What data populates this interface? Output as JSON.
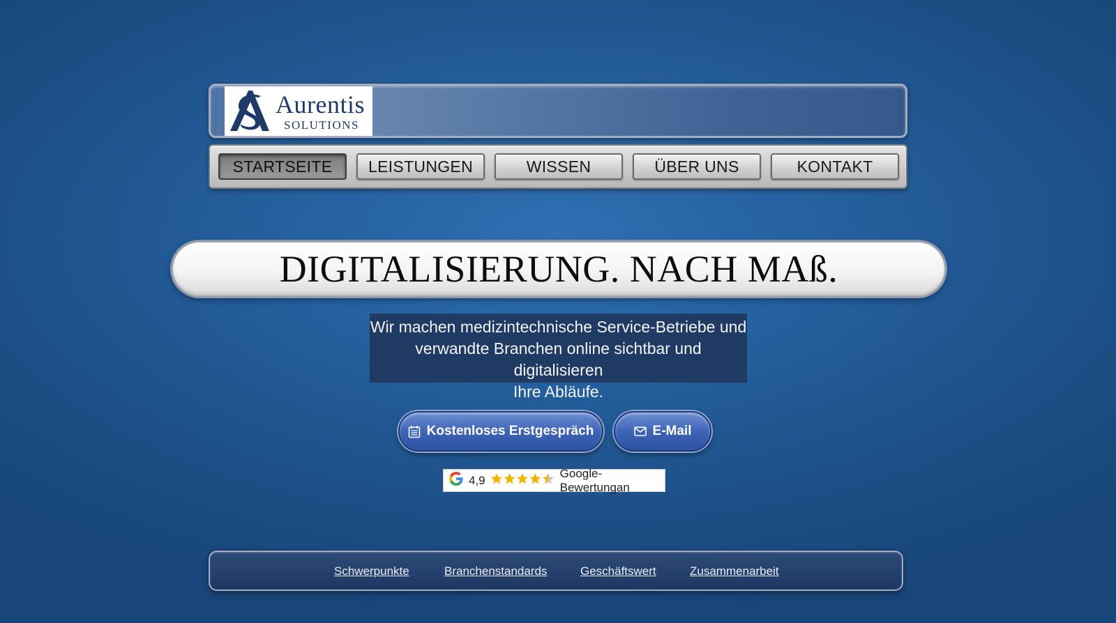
{
  "brand": {
    "name": "Aurentis",
    "tagline": "SOLUTIONS",
    "monogram": "AS",
    "color": "#1e3a6b"
  },
  "nav": {
    "items": [
      {
        "label": "STARTSEITE",
        "active": true
      },
      {
        "label": "LEISTUNGEN",
        "active": false
      },
      {
        "label": "WISSEN",
        "active": false
      },
      {
        "label": "ÜBER UNS",
        "active": false
      },
      {
        "label": "KONTAKT",
        "active": false
      }
    ]
  },
  "hero": {
    "title": "DIGITALISIERUNG. NACH MAß.",
    "subtitle_lines": [
      "Wir machen medizintechnische Service-Betriebe und",
      "verwandte Branchen online sichtbar und digitalisieren",
      "Ihre Abläufe."
    ]
  },
  "cta": {
    "primary": {
      "label": "Kostenloses Erstgespräch",
      "icon": "calendar-icon"
    },
    "secondary": {
      "label": "E-Mail",
      "icon": "mail-icon"
    }
  },
  "rating": {
    "score": "4,9",
    "stars": 4.5,
    "label": "Google-Bewertungan",
    "icon": "google-icon"
  },
  "footer": {
    "links": [
      "Schwerpunkte",
      "Branchenstandards",
      "Geschäftswert",
      "Zusammenarbeit"
    ]
  },
  "colors": {
    "background": "#25609f",
    "cta_blue": "#3e64b6",
    "subtitle_bg": "#203b63",
    "star": "#f4b400"
  }
}
